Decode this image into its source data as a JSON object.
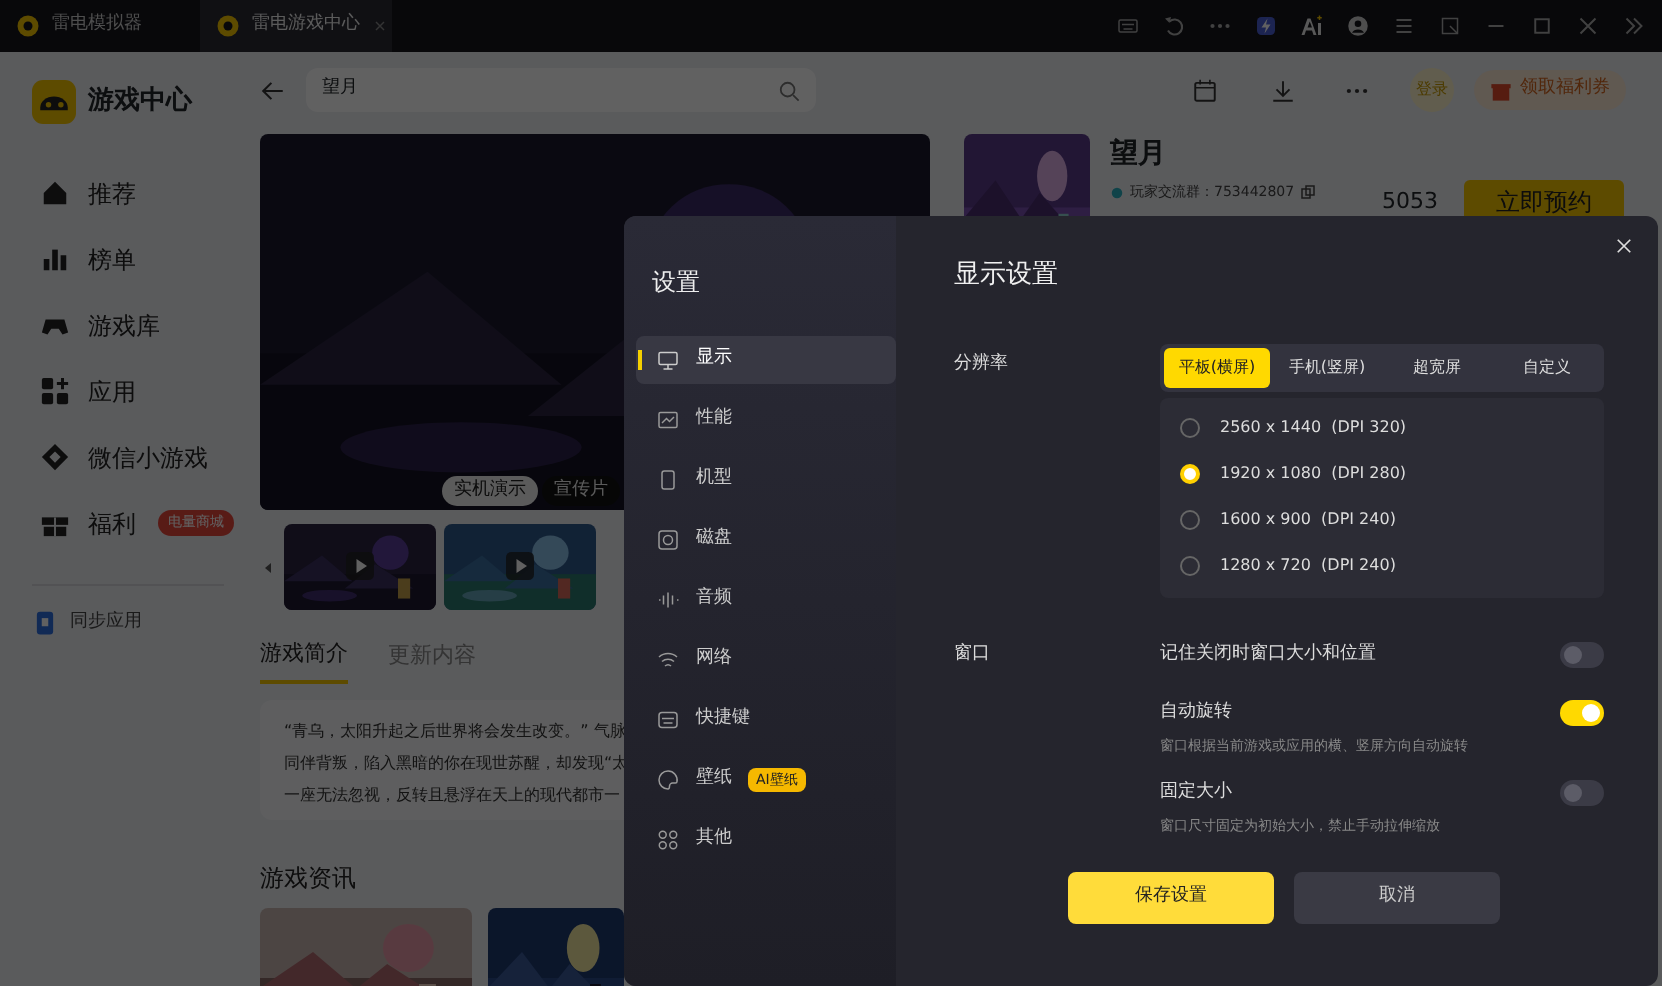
{
  "title_bar": {
    "tabs": [
      {
        "label": "雷电模拟器",
        "selected": false
      },
      {
        "label": "雷电游戏中心",
        "selected": true
      }
    ]
  },
  "sidebar": {
    "title": "游戏中心",
    "items": [
      {
        "label": "推荐"
      },
      {
        "label": "榜单"
      },
      {
        "label": "游戏库"
      },
      {
        "label": "应用"
      },
      {
        "label": "微信小游戏"
      },
      {
        "label": "福利",
        "badge": "电量商城"
      }
    ],
    "sync": "同步应用"
  },
  "search": {
    "value": "望月"
  },
  "header": {
    "login": "登录",
    "coupon": "领取福利券"
  },
  "media": {
    "tags": [
      {
        "label": "实机演示",
        "selected": true
      },
      {
        "label": "宣传片",
        "selected": false
      }
    ]
  },
  "content_tabs": [
    {
      "label": "游戏简介",
      "selected": true
    },
    {
      "label": "更新内容",
      "selected": false
    }
  ],
  "description": [
    "“青乌，太阳升起之后世界将会发生改变。” 气脉",
    "同伴背叛，陷入黑暗的你在现世苏醒，却发现“太",
    "一座无法忽视，反转且悬浮在天上的现代都市一"
  ],
  "news_title": "游戏资讯",
  "game": {
    "name": "望月",
    "group": "玩家交流群：753442807",
    "count": "5053",
    "action": "立即预约"
  },
  "dialog": {
    "title": "设置",
    "nav": [
      {
        "label": "显示",
        "selected": true
      },
      {
        "label": "性能",
        "selected": false
      },
      {
        "label": "机型",
        "selected": false
      },
      {
        "label": "磁盘",
        "selected": false
      },
      {
        "label": "音频",
        "selected": false
      },
      {
        "label": "网络",
        "selected": false
      },
      {
        "label": "快捷键",
        "selected": false
      },
      {
        "label": "壁纸",
        "selected": false,
        "badge": "AI壁纸"
      },
      {
        "label": "其他",
        "selected": false
      }
    ],
    "heading": "显示设置",
    "resolution": {
      "label": "分辨率",
      "modes": [
        {
          "label": "平板(横屏)",
          "selected": true
        },
        {
          "label": "手机(竖屏)",
          "selected": false
        },
        {
          "label": "超宽屏",
          "selected": false
        },
        {
          "label": "自定义",
          "selected": false
        }
      ],
      "options": [
        {
          "label": "2560 x 1440  (DPI 320)",
          "selected": false
        },
        {
          "label": "1920 x 1080  (DPI 280)",
          "selected": true
        },
        {
          "label": "1600 x 900  (DPI 240)",
          "selected": false
        },
        {
          "label": "1280 x 720  (DPI 240)",
          "selected": false
        }
      ]
    },
    "window": {
      "label": "窗口",
      "settings": [
        {
          "label": "记住关闭时窗口大小和位置",
          "on": false
        },
        {
          "label": "自动旋转",
          "hint": "窗口根据当前游戏或应用的横、竖屏方向自动旋转",
          "on": true
        },
        {
          "label": "固定大小",
          "hint": "窗口尺寸固定为初始大小，禁止手动拉伸缩放",
          "on": false
        }
      ]
    },
    "buttons": {
      "save": "保存设置",
      "cancel": "取消"
    }
  }
}
